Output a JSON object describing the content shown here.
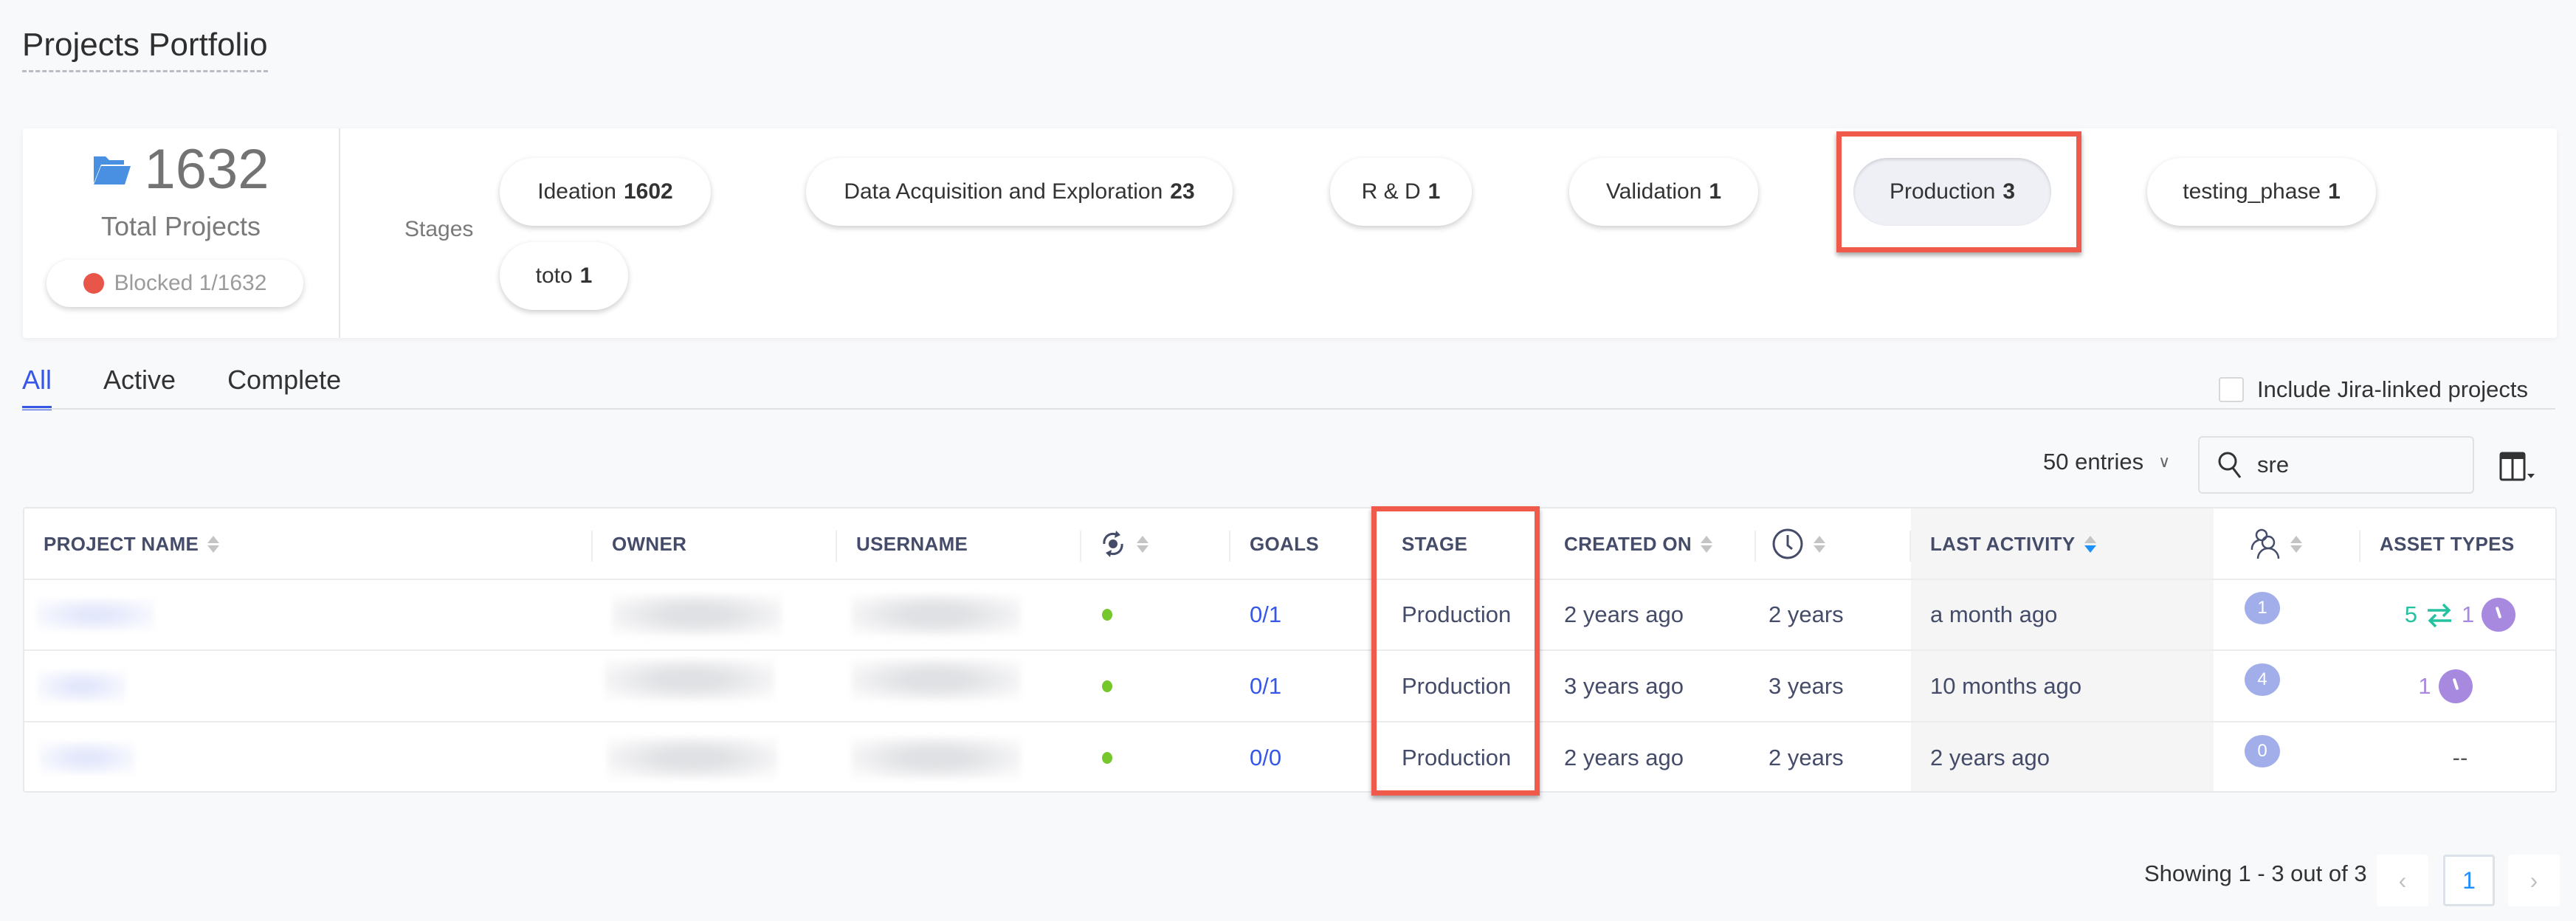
{
  "page": {
    "title": "Projects Portfolio"
  },
  "summary": {
    "total_count": "1632",
    "total_label": "Total Projects",
    "blocked_label": "Blocked 1/1632",
    "stages_label": "Stages",
    "stages": [
      {
        "name": "Ideation",
        "count": "1602",
        "active": false
      },
      {
        "name": "Data Acquisition and Exploration",
        "count": "23",
        "active": false
      },
      {
        "name": "R & D",
        "count": "1",
        "active": false
      },
      {
        "name": "Validation",
        "count": "1",
        "active": false
      },
      {
        "name": "Production",
        "count": "3",
        "active": true
      },
      {
        "name": "testing_phase",
        "count": "1",
        "active": false
      },
      {
        "name": "toto",
        "count": "1",
        "active": false
      }
    ]
  },
  "tabs": [
    {
      "label": "All",
      "active": true
    },
    {
      "label": "Active",
      "active": false
    },
    {
      "label": "Complete",
      "active": false
    }
  ],
  "filters": {
    "jira_label": "Include Jira-linked projects",
    "jira_checked": false,
    "entries_label": "50 entries",
    "search_value": "sre"
  },
  "table": {
    "headers": {
      "project_name": "PROJECT NAME",
      "owner": "OWNER",
      "username": "USERNAME",
      "status": "status-sync-icon",
      "goals": "GOALS",
      "stage": "STAGE",
      "created_on": "CREATED ON",
      "duration": "clock-icon",
      "last_activity": "LAST ACTIVITY",
      "members": "members-icon",
      "asset_types": "ASSET TYPES"
    },
    "sorted_by": "last_activity",
    "sort_direction": "descending",
    "rows": [
      {
        "goals": "0/1",
        "stage": "Production",
        "created_on": "2 years ago",
        "duration": "2 years",
        "last_activity": "a month ago",
        "members": "1",
        "assets": {
          "teal_count": "5",
          "purple_count": "1",
          "dash": ""
        }
      },
      {
        "goals": "0/1",
        "stage": "Production",
        "created_on": "3 years ago",
        "duration": "3 years",
        "last_activity": "10 months ago",
        "members": "4",
        "assets": {
          "teal_count": "",
          "purple_count": "1",
          "dash": ""
        }
      },
      {
        "goals": "0/0",
        "stage": "Production",
        "created_on": "2 years ago",
        "duration": "2 years",
        "last_activity": "2 years ago",
        "members": "0",
        "assets": {
          "teal_count": "",
          "purple_count": "",
          "dash": "--"
        }
      }
    ]
  },
  "pagination": {
    "showing": "Showing 1 - 3 out of 3",
    "current_page": "1",
    "prev": "‹",
    "next": "›"
  },
  "colors": {
    "accent": "#3657e8",
    "highlight": "#f05a4a",
    "status_green": "#76c72c",
    "blocked_red": "#e8564a",
    "teal": "#25c2a0",
    "purple": "#a889e0"
  }
}
